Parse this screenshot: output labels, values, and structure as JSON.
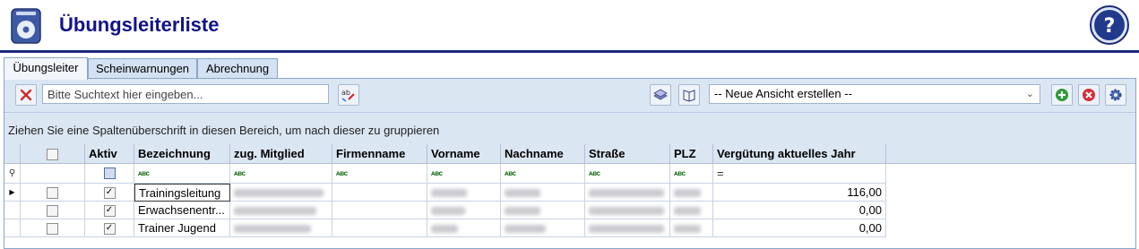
{
  "header": {
    "title": "Übungsleiterliste"
  },
  "tabs": [
    {
      "label": "Übungsleiter",
      "active": true
    },
    {
      "label": "Scheinwarnungen",
      "active": false
    },
    {
      "label": "Abrechnung",
      "active": false
    }
  ],
  "toolbar": {
    "search_placeholder": "Bitte Suchtext hier eingeben...",
    "view_select_value": "-- Neue Ansicht erstellen --"
  },
  "group_hint": "Ziehen Sie eine Spaltenüberschrift in diesen Bereich, um nach dieser zu gruppieren",
  "grid": {
    "columns": [
      "",
      "Aktiv",
      "Bezeichnung",
      "zug. Mitglied",
      "Firmenname",
      "Vorname",
      "Nachname",
      "Straße",
      "PLZ",
      "Vergütung aktuelles Jahr"
    ],
    "filter_op": "=",
    "rows": [
      {
        "selected": false,
        "aktiv": true,
        "bezeichnung": "Trainingsleitung",
        "verguetung": "116,00",
        "current": true
      },
      {
        "selected": false,
        "aktiv": true,
        "bezeichnung": "Erwachsenentr...",
        "verguetung": "0,00",
        "current": false
      },
      {
        "selected": false,
        "aktiv": true,
        "bezeichnung": "Trainer Jugend",
        "verguetung": "0,00",
        "current": false
      }
    ]
  },
  "colors": {
    "accent": "#12128a",
    "header_line": "#1b2a7a",
    "panel_bg": "#dbe6f3"
  }
}
